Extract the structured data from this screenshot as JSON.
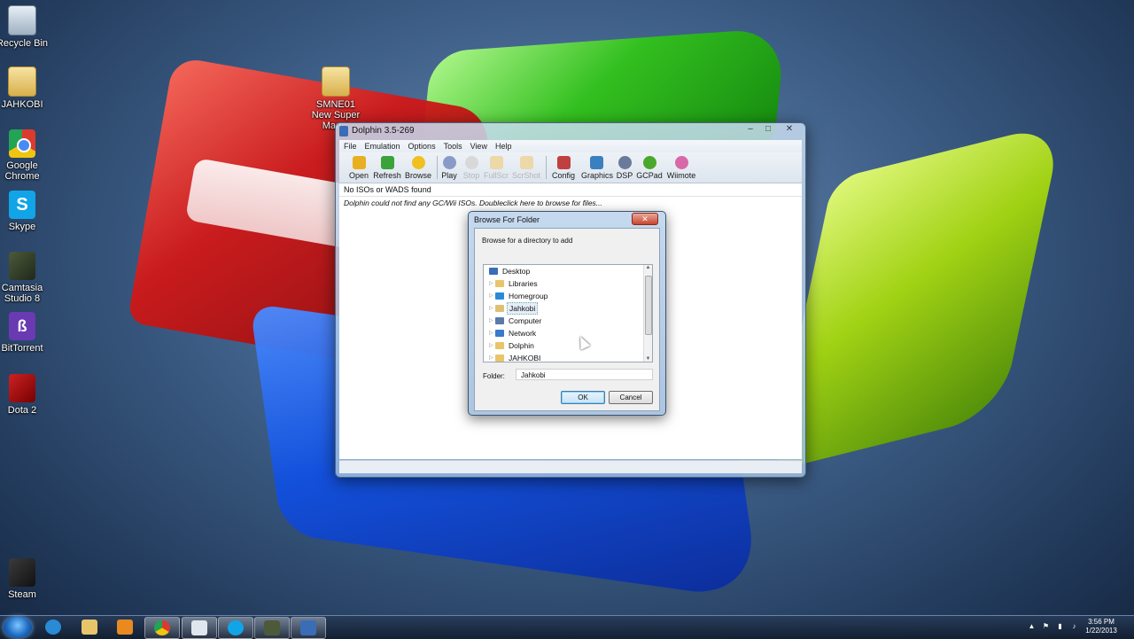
{
  "desktop": {
    "icons": [
      {
        "label": "Recycle Bin"
      },
      {
        "label": "JAHKOBI"
      },
      {
        "label": "SMNE01 New Super Man..."
      },
      {
        "label": "Google Chrome"
      },
      {
        "label": "Skype"
      },
      {
        "label": "Camtasia Studio 8"
      },
      {
        "label": "BitTorrent"
      },
      {
        "label": "Dota 2"
      },
      {
        "label": "Steam"
      }
    ]
  },
  "window": {
    "title": "Dolphin 3.5-269",
    "controls": {
      "minimize": "–",
      "maximize": "□",
      "close": "✕"
    },
    "menu": [
      "File",
      "Emulation",
      "Options",
      "Tools",
      "View",
      "Help"
    ],
    "toolbar": [
      {
        "label": "Open",
        "icon": "folder-open-icon",
        "color": "#e8b020",
        "enabled": true
      },
      {
        "label": "Refresh",
        "icon": "refresh-icon",
        "color": "#3aa33a",
        "enabled": true
      },
      {
        "label": "Browse",
        "icon": "star-icon",
        "color": "#f0c020",
        "enabled": true
      },
      {
        "label": "Play",
        "icon": "play-icon",
        "color": "#8a9ac8",
        "enabled": true
      },
      {
        "label": "Stop",
        "icon": "stop-icon",
        "color": "#d8d8d8",
        "enabled": false
      },
      {
        "label": "FullScr",
        "icon": "fullscreen-icon",
        "color": "#ecd8a8",
        "enabled": false
      },
      {
        "label": "ScrShot",
        "icon": "screenshot-icon",
        "color": "#ecd8a8",
        "enabled": false
      },
      {
        "label": "Config",
        "icon": "wrench-icon",
        "color": "#c04040",
        "enabled": true
      },
      {
        "label": "Graphics",
        "icon": "monitor-icon",
        "color": "#3a80c0",
        "enabled": true
      },
      {
        "label": "DSP",
        "icon": "speaker-icon",
        "color": "#6a7a9a",
        "enabled": true
      },
      {
        "label": "GCPad",
        "icon": "gamecube-pad-icon",
        "color": "#4aa82a",
        "enabled": true
      },
      {
        "label": "Wiimote",
        "icon": "wiimote-icon",
        "color": "#d868a8",
        "enabled": true
      }
    ],
    "list_header": "No ISOs or WADS found",
    "message": "Dolphin could not find any GC/Wii ISOs.  Doubleclick here to browse for files..."
  },
  "dialog": {
    "title": "Browse For Folder",
    "close": "✕",
    "prompt": "Browse for a directory to add",
    "tree": [
      {
        "label": "Desktop",
        "icon": "desktop-icon",
        "expander": false
      },
      {
        "label": "Libraries",
        "icon": "libraries-icon",
        "expander": true
      },
      {
        "label": "Homegroup",
        "icon": "homegroup-icon",
        "expander": true
      },
      {
        "label": "Jahkobi",
        "icon": "user-folder-icon",
        "expander": true,
        "selected": true
      },
      {
        "label": "Computer",
        "icon": "computer-icon",
        "expander": true
      },
      {
        "label": "Network",
        "icon": "network-icon",
        "expander": true
      },
      {
        "label": "Dolphin",
        "icon": "folder-icon",
        "expander": true
      },
      {
        "label": "JAHKOBI",
        "icon": "folder-icon",
        "expander": true
      }
    ],
    "folder_label": "Folder:",
    "folder_value": "Jahkobi",
    "ok": "OK",
    "cancel": "Cancel"
  },
  "taskbar": {
    "time": "3:56 PM",
    "date": "1/22/2013",
    "pinned": [
      "internet-explorer-icon",
      "explorer-icon",
      "media-player-icon",
      "chrome-icon",
      "notepad-icon",
      "skype-icon",
      "camtasia-icon",
      "dolphin-icon"
    ]
  }
}
